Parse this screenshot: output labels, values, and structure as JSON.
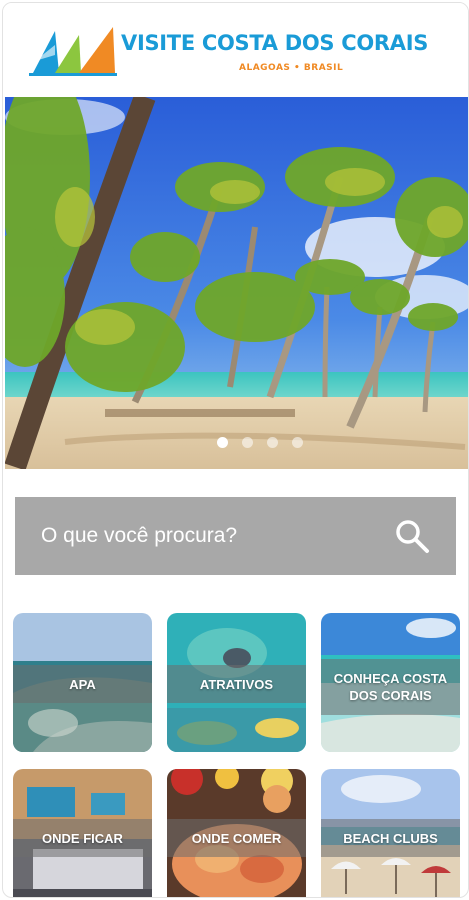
{
  "brand": {
    "title": "VISITE COSTA DOS CORAIS",
    "subtitle": "ALAGOAS • BRASIL",
    "colors": {
      "primary": "#1a9bd7",
      "accent": "#f08a24",
      "green": "#8cc63f"
    }
  },
  "hero": {
    "slides_total": 4,
    "active_slide": 1,
    "image": "palm-beach-photo"
  },
  "search": {
    "placeholder": "O que você procura?",
    "icon": "search-icon"
  },
  "tiles": [
    {
      "label": "APA",
      "scene": "aerial-coastline"
    },
    {
      "label": "ATRATIVOS",
      "scene": "diver-underwater"
    },
    {
      "label": "CONHEÇA COSTA DOS CORAIS",
      "scene": "turquoise-shore"
    },
    {
      "label": "ONDE FICAR",
      "scene": "hotel-room"
    },
    {
      "label": "ONDE COMER",
      "scene": "seafood-dish"
    },
    {
      "label": "BEACH CLUBS",
      "scene": "beach-umbrellas"
    }
  ]
}
